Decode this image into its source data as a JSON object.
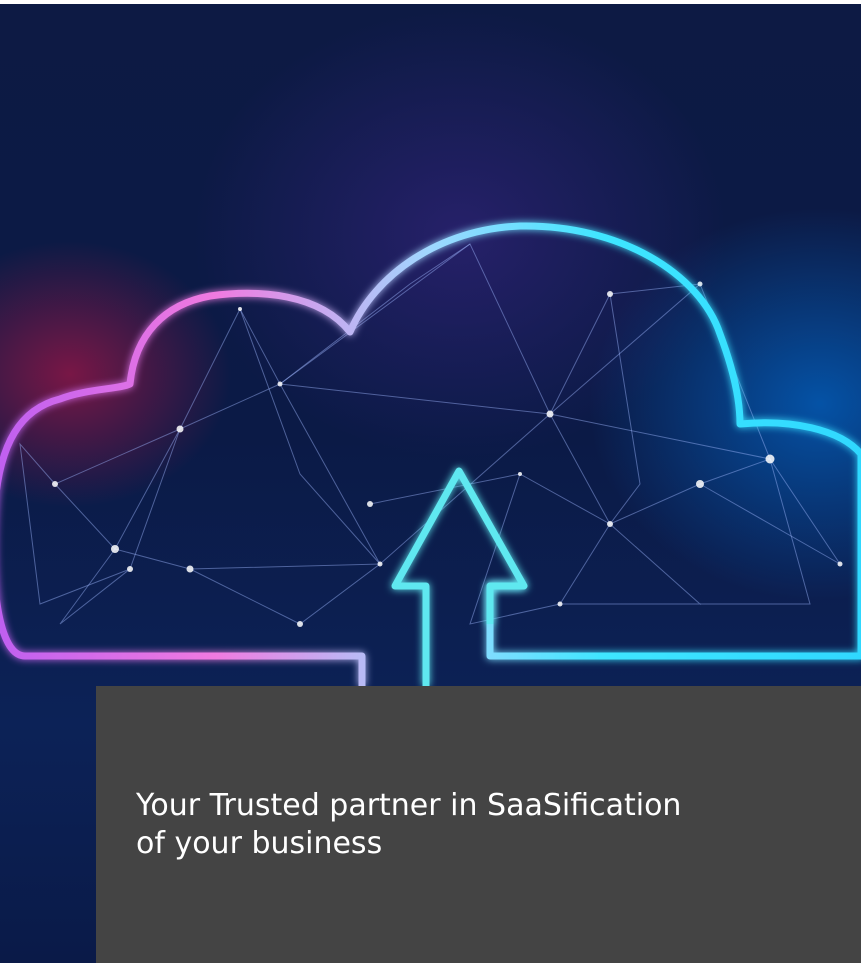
{
  "hero": {
    "image_subject": "cloud-upload-network-icon",
    "colors": {
      "background": "#0b1a46",
      "cloud_left": "#ff7ad9",
      "cloud_right": "#29e6ff",
      "arrow": "#5fe8f0",
      "caption_panel": "#444444",
      "caption_text": "#ffffff"
    }
  },
  "caption": {
    "text": "Your Trusted partner in SaaSification\nof your business"
  }
}
